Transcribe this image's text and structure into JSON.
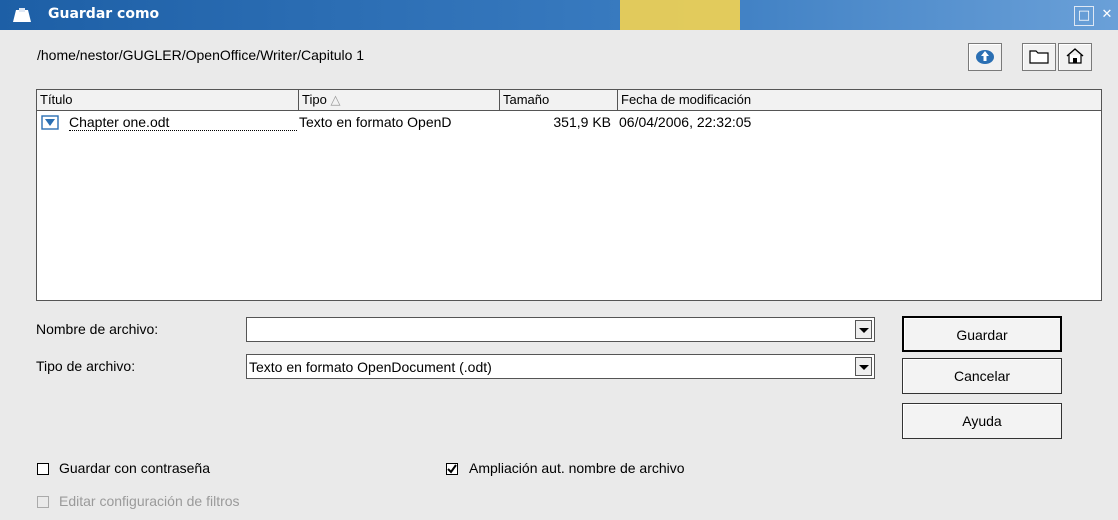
{
  "window": {
    "title": "Guardar como",
    "restore_glyph": "□",
    "close_glyph": "✕"
  },
  "path": "/home/nestor/GUGLER/OpenOffice/Writer/Capitulo 1",
  "toolbar": {
    "up_icon": "up-folder-icon",
    "new_folder_icon": "new-folder-icon",
    "home_icon": "home-icon"
  },
  "columns": [
    "Título",
    "Tipo",
    "Tamaño",
    "Fecha de modificación"
  ],
  "sort_indicator": "△",
  "files": [
    {
      "name": "Chapter one.odt",
      "type": "Texto en formato OpenD",
      "size": "351,9 KB",
      "modified": "06/04/2006, 22:32:05"
    }
  ],
  "form": {
    "filename_label": "Nombre de archivo:",
    "filename_value": "",
    "filetype_label": "Tipo de archivo:",
    "filetype_value": "Texto en formato OpenDocument (.odt)"
  },
  "buttons": {
    "save": "Guardar",
    "cancel": "Cancelar",
    "help": "Ayuda"
  },
  "options": {
    "password": {
      "label": "Guardar con contraseña",
      "checked": false,
      "enabled": true
    },
    "auto_ext": {
      "label": "Ampliación aut. nombre de archivo",
      "checked": true,
      "enabled": true
    },
    "filter_settings": {
      "label": "Editar configuración de filtros",
      "checked": false,
      "enabled": false
    }
  },
  "colors": {
    "titlebar": "#1d5fa6",
    "accent": "#ffd84a"
  }
}
